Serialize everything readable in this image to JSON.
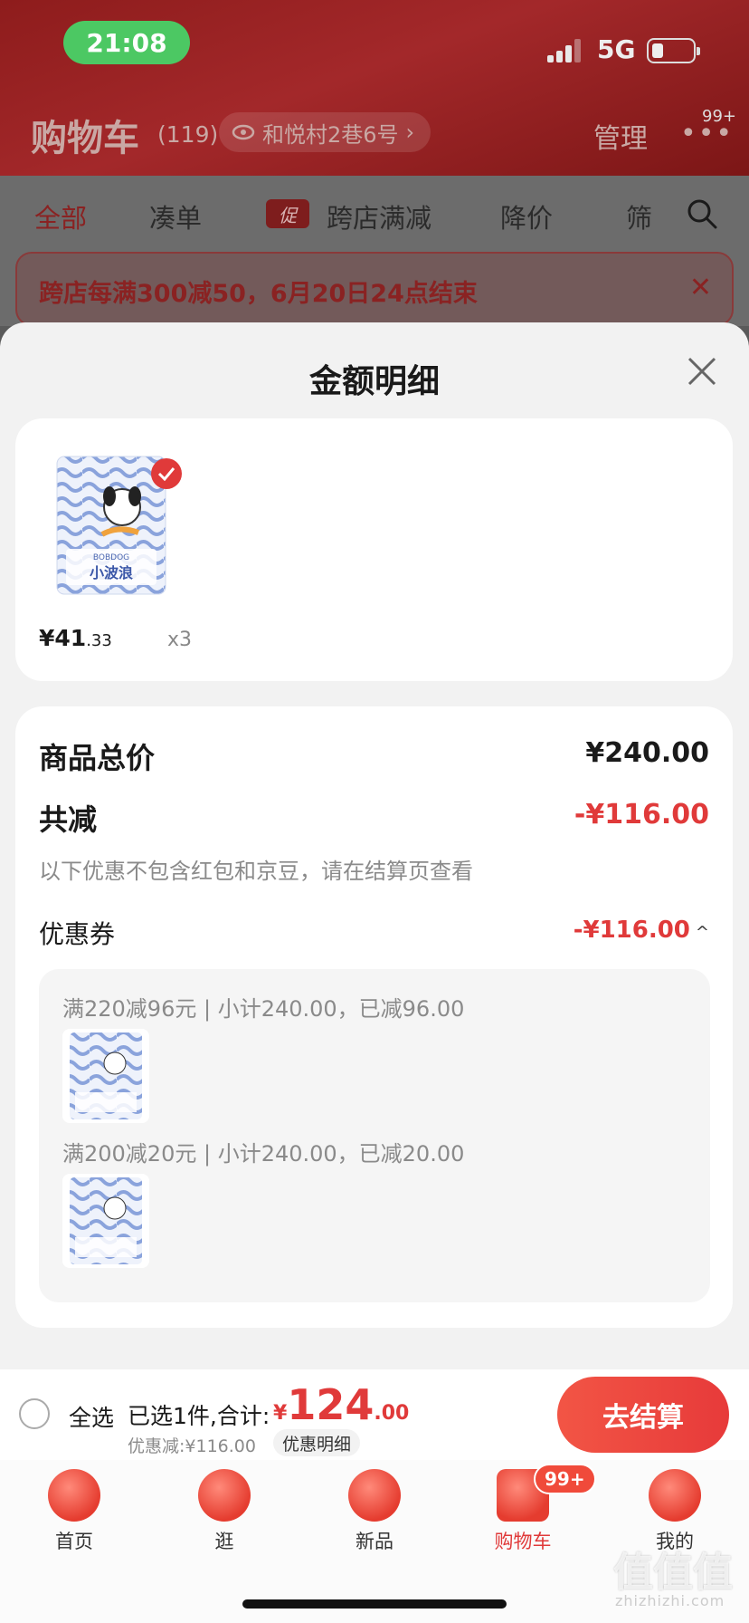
{
  "status_bar": {
    "time": "21:08",
    "network": "5G"
  },
  "header": {
    "title": "购物车",
    "count": "(119)",
    "address": "和悦村2巷6号",
    "manage": "管理",
    "more": "•••",
    "more_badge": "99+"
  },
  "tabs": [
    {
      "label": "全部",
      "active": true
    },
    {
      "label": "凑单",
      "active": false
    },
    {
      "label": "跨店满减",
      "active": false,
      "tag": "促"
    },
    {
      "label": "降价",
      "active": false
    },
    {
      "label": "筛",
      "active": false
    }
  ],
  "promo_banner": {
    "text": "跨店每满300减50，6月20日24点结束"
  },
  "sheet": {
    "title": "金额明细",
    "product": {
      "price_int": "¥41",
      "price_dec": ".33",
      "qty": "x3",
      "brand": "BOBDOG",
      "name": "小波浪"
    },
    "total_label": "商品总价",
    "total_value": "¥240.00",
    "reduce_label": "共减",
    "reduce_value": "-¥116.00",
    "note": "以下优惠不包含红包和京豆，请在结算页查看",
    "coupon_label": "优惠券",
    "coupon_value": "-¥116.00",
    "coupons": [
      {
        "text": "满220减96元 | 小计240.00，已减96.00"
      },
      {
        "text": "满200减20元 | 小计240.00，已减20.00"
      }
    ]
  },
  "action_bar": {
    "select_all": "全选",
    "selected": "已选1件,合计:",
    "total_cur": "¥",
    "total_int": "124",
    "total_dec": ".00",
    "discount": "优惠减:¥116.00",
    "detail": "优惠明细",
    "checkout": "去结算"
  },
  "tabbar": [
    {
      "label": "首页",
      "icon": "home-icon"
    },
    {
      "label": "逛",
      "icon": "browse-icon"
    },
    {
      "label": "新品",
      "icon": "new-icon"
    },
    {
      "label": "购物车",
      "icon": "cart-icon",
      "badge": "99+",
      "active": true
    },
    {
      "label": "我的",
      "icon": "profile-icon"
    }
  ],
  "watermark": {
    "text": "值值值",
    "sub": "zhizhizhi.com"
  },
  "colors": {
    "accent": "#e03a3a",
    "header": "#a3282a",
    "sheet_bg": "#f2f2f2"
  }
}
